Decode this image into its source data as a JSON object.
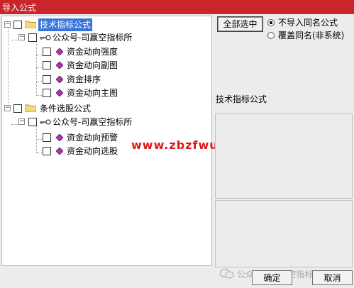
{
  "window": {
    "title": "导入公式"
  },
  "tree": {
    "groups": [
      {
        "label": "技术指标公式",
        "author": "公众号-司赢空指标所",
        "items": [
          "资金动向强度",
          "资金动向副图",
          "资金排序",
          "资金动向主图"
        ]
      },
      {
        "label": "条件选股公式",
        "author": "公众号-司赢空指标所",
        "items": [
          "资金动向预警",
          "资金动向选股"
        ]
      }
    ]
  },
  "controls": {
    "select_all": "全部选中",
    "radio_skip": "不导入同名公式",
    "radio_overwrite": "覆盖同名(非系统)",
    "section_label": "技术指标公式",
    "ok": "确定",
    "cancel": "取消"
  },
  "watermark": {
    "site": "www.zbzfwu.com",
    "footer": "公众号 · 司赢空指标所"
  },
  "colors": {
    "titlebar": "#c8262b",
    "selection": "#3874d8",
    "watermark": "#e01818"
  }
}
